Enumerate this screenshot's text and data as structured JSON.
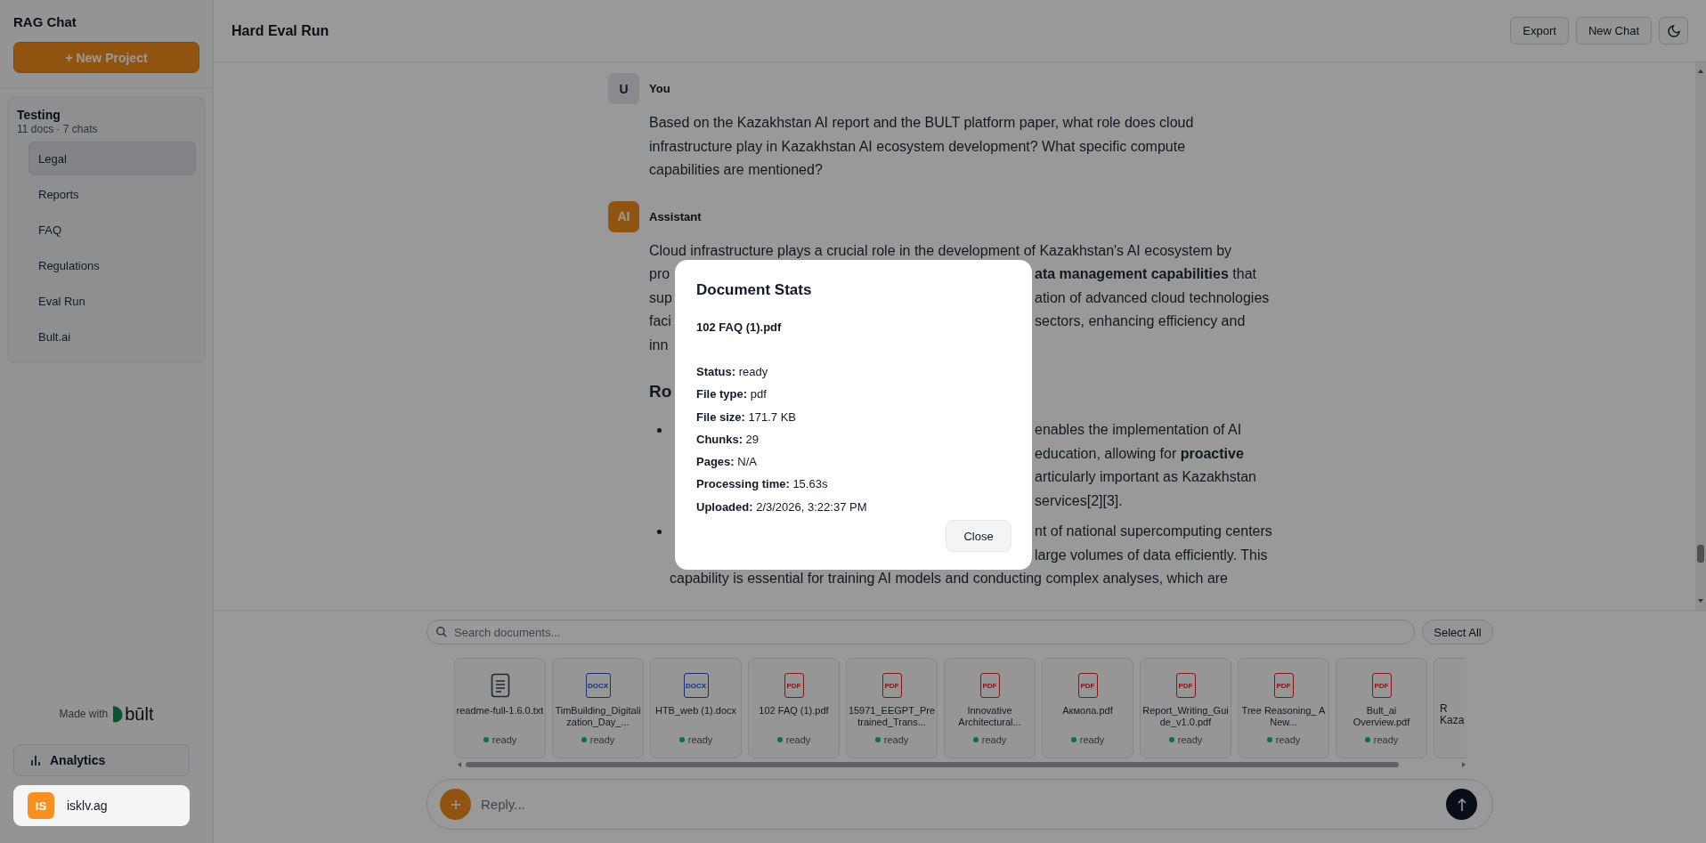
{
  "sidebar": {
    "title": "RAG Chat",
    "new_project_button": "+ New Project",
    "project": {
      "name": "Testing",
      "meta": "11 docs · 7 chats",
      "items": [
        {
          "label": "Legal",
          "selected": true
        },
        {
          "label": "Reports",
          "selected": false
        },
        {
          "label": "FAQ",
          "selected": false
        },
        {
          "label": "Regulations",
          "selected": false
        },
        {
          "label": "Eval Run",
          "selected": false
        },
        {
          "label": "Bult.ai",
          "selected": false
        }
      ]
    },
    "made_with": "Made with",
    "brand": "būlt",
    "analytics_button": "Analytics",
    "user": {
      "initials": "IS",
      "name": "isklv.ag"
    }
  },
  "header": {
    "title": "Hard Eval Run",
    "buttons": [
      "Export",
      "New Chat"
    ]
  },
  "messages": [
    {
      "kind": "user",
      "avatar": "U",
      "author": "You",
      "text": "Based on the Kazakhstan AI report and the BULT platform paper, what role does cloud infrastructure play in Kazakhstan AI ecosystem development? What specific compute capabilities are mentioned?"
    },
    {
      "kind": "assistant",
      "avatar": "AI",
      "author": "Assistant",
      "blocks": [
        {
          "kind": "text",
          "left": "Cloud infrastructure plays a crucial role in the development of Kazakhstan's AI ecosystem by"
        },
        {
          "kind": "text",
          "left": "pro",
          "right": "**ata management capabilities** that"
        },
        {
          "kind": "text",
          "left": "sup",
          "right": "ation of advanced cloud technologies"
        },
        {
          "kind": "text",
          "left": "faci",
          "right": "sectors, enhancing efficiency and"
        },
        {
          "kind": "text",
          "left": "inn"
        },
        {
          "kind": "heading",
          "left": "Ro"
        },
        {
          "kind": "bullet",
          "right": "enables the implementation of AI"
        },
        {
          "kind": "cont",
          "right": "education, allowing for **proactive**"
        },
        {
          "kind": "cont",
          "right": "articularly important as Kazakhstan"
        },
        {
          "kind": "cont",
          "right": "services[2][3]."
        },
        {
          "kind": "bullet",
          "right": "nt of national supercomputing centers"
        },
        {
          "kind": "cont",
          "right": "large volumes of data efficiently. This"
        },
        {
          "kind": "cont",
          "left": "capability is essential for training AI models and conducting complex analyses, which are"
        }
      ]
    }
  ],
  "documents": {
    "search_placeholder": "Search documents...",
    "select_all_button": "Select All",
    "items": [
      {
        "kind": "txt",
        "name": "readme-full-1.6.0.txt",
        "status": "ready"
      },
      {
        "kind": "docx",
        "badge": "DOCX",
        "name": "TimBuilding_Digitalization_Day_...",
        "status": "ready"
      },
      {
        "kind": "docx",
        "badge": "DOCX",
        "name": "HTB_web (1).docx",
        "status": "ready"
      },
      {
        "kind": "pdf",
        "badge": "PDF",
        "name": "102 FAQ (1).pdf",
        "status": "ready"
      },
      {
        "kind": "pdf",
        "badge": "PDF",
        "name": "15971_EEGPT_Pretrained_Trans...",
        "status": "ready"
      },
      {
        "kind": "pdf",
        "badge": "PDF",
        "name": "Innovative Architectural...",
        "status": "ready"
      },
      {
        "kind": "pdf",
        "badge": "PDF",
        "name": "Акмола.pdf",
        "status": "ready"
      },
      {
        "kind": "pdf",
        "badge": "PDF",
        "name": "Report_Writing_Guide_v1.0.pdf",
        "status": "ready"
      },
      {
        "kind": "pdf",
        "badge": "PDF",
        "name": "Tree Reasoning_ A New...",
        "status": "ready"
      },
      {
        "kind": "pdf",
        "badge": "PDF",
        "name": "Bult_ai Overview.pdf",
        "status": "ready"
      },
      {
        "kind": "partial",
        "lines": [
          "R",
          "Kaza"
        ]
      }
    ]
  },
  "reply": {
    "placeholder": "Reply..."
  },
  "modal": {
    "title": "Document Stats",
    "file": "102 FAQ (1).pdf",
    "fields": [
      {
        "label": "Status:",
        "value": "ready"
      },
      {
        "label": "File type:",
        "value": "pdf"
      },
      {
        "label": "File size:",
        "value": "171.7 KB"
      },
      {
        "label": "Chunks:",
        "value": "29"
      },
      {
        "label": "Pages:",
        "value": "N/A"
      },
      {
        "label": "Processing time:",
        "value": "15.63s"
      },
      {
        "label": "Uploaded:",
        "value": "2/3/2026, 3:22:37 PM"
      }
    ],
    "close_button": "Close"
  }
}
